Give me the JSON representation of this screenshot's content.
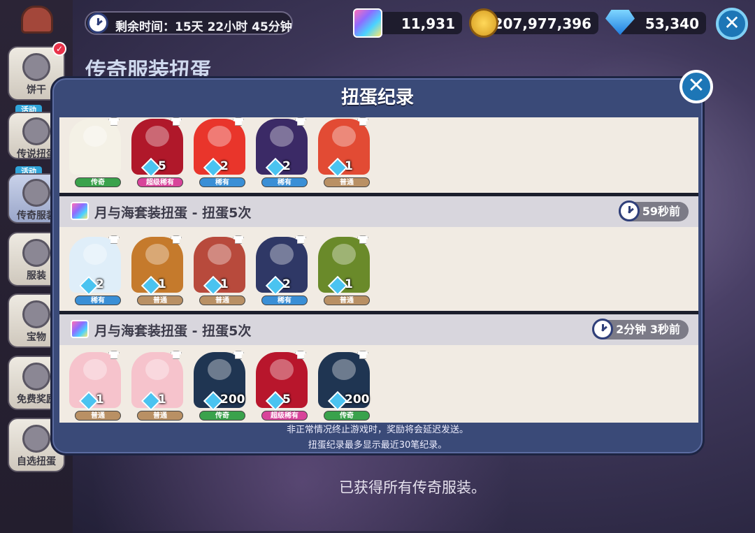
{
  "top_bar": {
    "timer_label": "剩余时间：15天 22小时 45分钟",
    "currencies": [
      {
        "name": "cube-icon",
        "value": "11,931"
      },
      {
        "name": "coin-icon",
        "value": "207,977,396"
      },
      {
        "name": "gem-icon",
        "value": "53,340"
      }
    ],
    "close": "✕"
  },
  "sidebar": {
    "items": [
      {
        "label": "饼干",
        "badge": ""
      },
      {
        "label": "传说扭蛋",
        "badge": "活动"
      },
      {
        "label": "传奇服装",
        "badge": "活动"
      },
      {
        "label": "服装",
        "badge": ""
      },
      {
        "label": "宝物",
        "badge": ""
      },
      {
        "label": "免费奖励",
        "badge": ""
      },
      {
        "label": "自选扭蛋",
        "badge": ""
      }
    ],
    "check_mark": "✓"
  },
  "background": {
    "title": "传奇服装扭蛋",
    "footer": "已获得所有传奇服装。"
  },
  "modal": {
    "title": "扭蛋纪录",
    "close": "✕",
    "notes": [
      "非正常情况终止游戏时，奖励将会延迟发送。",
      "扭蛋纪录最多显示最近30笔纪录。"
    ],
    "records": [
      {
        "title": "",
        "time": "",
        "items": [
          {
            "qty": "",
            "rarity": "传奇",
            "color": "#f4f1e6",
            "accent": "#3aa24c"
          },
          {
            "qty": "5",
            "rarity": "超级稀有",
            "color": "#b0182a",
            "accent": "#d8439a"
          },
          {
            "qty": "2",
            "rarity": "稀有",
            "color": "#e9352b",
            "accent": "#3a8fd6"
          },
          {
            "qty": "2",
            "rarity": "稀有",
            "color": "#3b2a66",
            "accent": "#3a8fd6"
          },
          {
            "qty": "1",
            "rarity": "普通",
            "color": "#e24b34",
            "accent": "#b99064"
          }
        ]
      },
      {
        "title": "月与海套装扭蛋 - 扭蛋5次",
        "time": "59秒前",
        "items": [
          {
            "qty": "2",
            "rarity": "稀有",
            "color": "#dfeef9",
            "accent": "#3a8fd6"
          },
          {
            "qty": "1",
            "rarity": "普通",
            "color": "#c57a2c",
            "accent": "#b99064"
          },
          {
            "qty": "1",
            "rarity": "普通",
            "color": "#b84a3c",
            "accent": "#b99064"
          },
          {
            "qty": "2",
            "rarity": "稀有",
            "color": "#2f3866",
            "accent": "#3a8fd6"
          },
          {
            "qty": "1",
            "rarity": "普通",
            "color": "#6a8a2a",
            "accent": "#b99064"
          }
        ]
      },
      {
        "title": "月与海套装扭蛋 - 扭蛋5次",
        "time": "2分钟 3秒前",
        "items": [
          {
            "qty": "1",
            "rarity": "普通",
            "color": "#f6c3cc",
            "accent": "#b99064"
          },
          {
            "qty": "1",
            "rarity": "普通",
            "color": "#f6c3cc",
            "accent": "#b99064"
          },
          {
            "qty": "200",
            "rarity": "传奇",
            "color": "#1f3552",
            "accent": "#3aa24c"
          },
          {
            "qty": "5",
            "rarity": "超级稀有",
            "color": "#b8162c",
            "accent": "#d8439a"
          },
          {
            "qty": "200",
            "rarity": "传奇",
            "color": "#1f3552",
            "accent": "#3aa24c"
          }
        ]
      }
    ]
  }
}
